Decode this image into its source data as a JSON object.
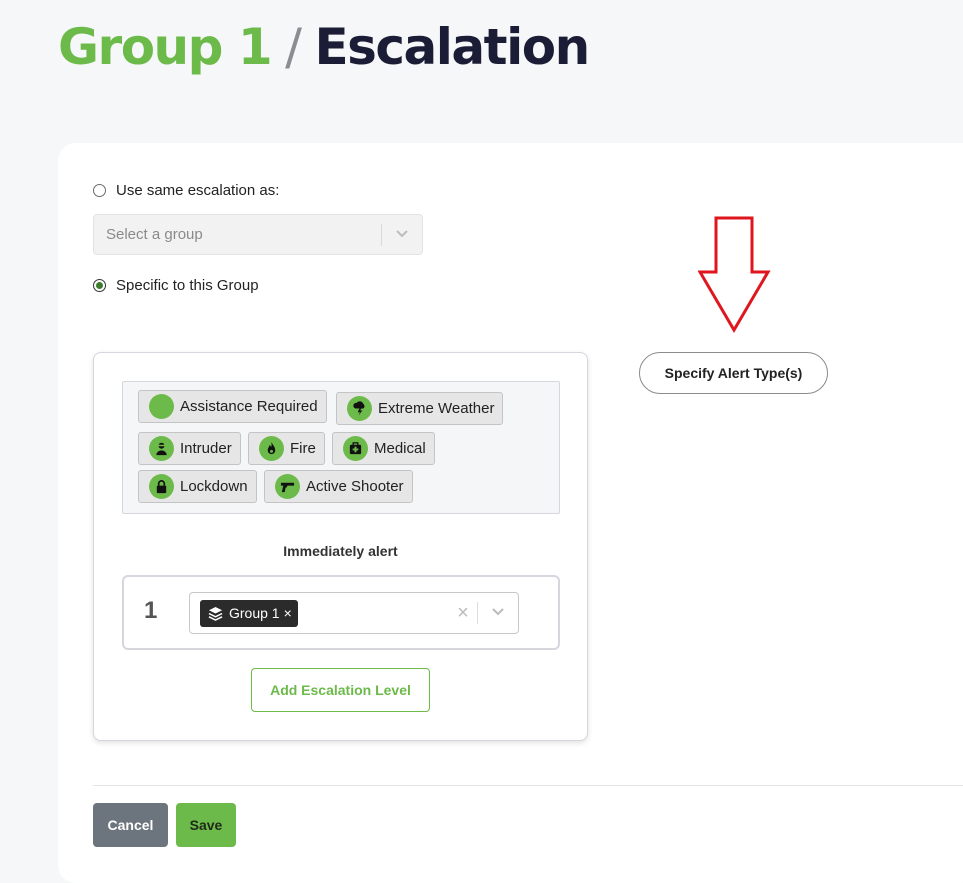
{
  "header": {
    "group_name": "Group 1",
    "separator": "/",
    "page_name": "Escalation"
  },
  "escalation": {
    "option_same_label": "Use same escalation as:",
    "option_same_selected": false,
    "group_select_placeholder": "Select a group",
    "option_specific_label": "Specific to this Group",
    "option_specific_selected": true
  },
  "alert_types": [
    {
      "label": "Assistance Required",
      "icon": "blank-circle-icon"
    },
    {
      "label": "Extreme Weather",
      "icon": "storm-icon"
    },
    {
      "label": "Intruder",
      "icon": "intruder-icon"
    },
    {
      "label": "Fire",
      "icon": "fire-icon"
    },
    {
      "label": "Medical",
      "icon": "medical-kit-icon"
    },
    {
      "label": "Lockdown",
      "icon": "lock-icon"
    },
    {
      "label": "Active Shooter",
      "icon": "gun-icon"
    }
  ],
  "levels": {
    "heading": "Immediately alert",
    "items": [
      {
        "number": "1",
        "tag": "Group 1",
        "tag_icon": "layers-icon",
        "remove": "×"
      }
    ],
    "clear_symbol": "×",
    "add_label": "Add Escalation Level"
  },
  "specify_button": "Specify Alert Type(s)",
  "footer": {
    "cancel_label": "Cancel",
    "save_label": "Save"
  },
  "colors": {
    "brand_green": "#6cba4a",
    "title_dark": "#1b1d36",
    "annotation_arrow": "#e0161e",
    "cancel_gray": "#6c757d"
  }
}
